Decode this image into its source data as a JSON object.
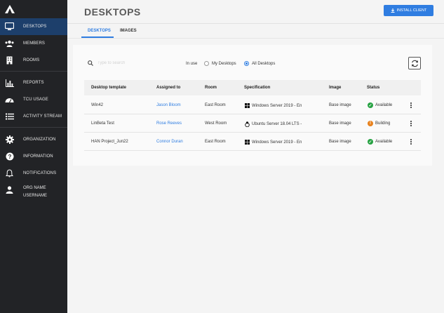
{
  "sidebar": {
    "items": [
      {
        "label": "DESKTOPS",
        "icon": "monitor-icon",
        "active": true
      },
      {
        "label": "MEMBERS",
        "icon": "users-icon"
      },
      {
        "label": "ROOMS",
        "icon": "building-icon"
      },
      {
        "label": "REPORTS",
        "icon": "bar-chart-icon"
      },
      {
        "label": "TCU USAGE",
        "icon": "gauge-icon"
      },
      {
        "label": "ACTIVITY STREAM",
        "icon": "list-icon"
      },
      {
        "label": "ORGANIZATION",
        "icon": "gear-icon"
      },
      {
        "label": "INFORMATION",
        "icon": "question-icon"
      },
      {
        "label": "NOTIFICATIONS",
        "icon": "bell-icon"
      }
    ],
    "org_name": "ORG NAME",
    "username": "USERNAME"
  },
  "header": {
    "title": "DESKTOPS",
    "install_label": "INSTALL CLIENT"
  },
  "tabs": [
    {
      "label": "DESKTOPS",
      "active": true
    },
    {
      "label": "IMAGES",
      "active": false
    }
  ],
  "filters": {
    "search_placeholder": "Type to search",
    "in_use_label": "In use",
    "options": [
      "My Desktops",
      "All Desktops"
    ],
    "selected": "All Desktops"
  },
  "table": {
    "headers": [
      "Desktop template",
      "Assigned to",
      "Room",
      "Specification",
      "Image",
      "Status"
    ],
    "rows": [
      {
        "template": "Win42",
        "assigned": "Jason Bloom",
        "room": "East Room",
        "spec": "Windows Server 2019 - En",
        "os": "windows-icon",
        "image": "Base image",
        "status": "Available",
        "status_color": "#27a243"
      },
      {
        "template": "LinBeta Test",
        "assigned": "Rose Reeves",
        "room": "West Room",
        "spec": "Ubuntu Server 18.04 LTS -",
        "os": "linux-icon",
        "image": "Base image",
        "status": "Building",
        "status_color": "#e8811c"
      },
      {
        "template": "HAN Project_Jun22",
        "assigned": "Connor Duran",
        "room": "East Room",
        "spec": "Windows Server 2019 - En",
        "os": "windows-icon",
        "image": "Base image",
        "status": "Available",
        "status_color": "#27a243"
      }
    ]
  },
  "colors": {
    "accent": "#2f7de1",
    "sidebar": "#222326",
    "available": "#27a243",
    "building": "#e8811c"
  }
}
